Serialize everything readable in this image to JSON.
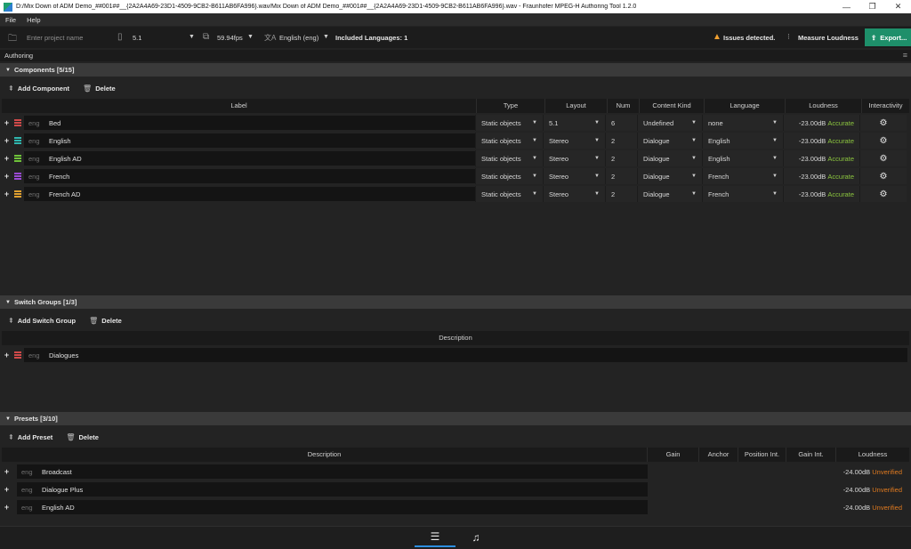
{
  "window": {
    "title": "D:/Mix Down of ADM Demo_##001##__{2A2A4A69-23D1-4509-9CB2-B611AB6FA996}.wav/Mix Down of ADM Demo_##001##__{2A2A4A69-23D1-4509-9CB2-B611AB6FA996}.wav - Fraunhofer MPEG-H Authoring Tool 1.2.0",
    "minimize": "—",
    "restore": "❐",
    "close": "✕"
  },
  "menu": {
    "file": "File",
    "help": "Help"
  },
  "toolbar": {
    "project_placeholder": "Enter project name",
    "layout": "5.1",
    "framerate": "59.94fps",
    "language": "English (eng)",
    "included_languages": "Included Languages: 1",
    "issues": "Issues detected.",
    "measure_loudness": "Measure Loudness",
    "export": "Export..."
  },
  "authoring_tab": "Authoring",
  "components": {
    "header": "Components [5/15]",
    "add": "Add Component",
    "delete": "Delete",
    "columns": [
      "Label",
      "Type",
      "Layout",
      "Num",
      "Content Kind",
      "Language",
      "Loudness",
      "Interactivity"
    ],
    "rows": [
      {
        "lang": "eng",
        "label": "Bed",
        "type": "Static objects",
        "layout": "5.1",
        "num": "6",
        "kind": "Undefined",
        "language": "none",
        "loudness": "-23.00dB",
        "status": "Accurate",
        "color": "#d14a4a"
      },
      {
        "lang": "eng",
        "label": "English",
        "type": "Static objects",
        "layout": "Stereo",
        "num": "2",
        "kind": "Dialogue",
        "language": "English",
        "loudness": "-23.00dB",
        "status": "Accurate",
        "color": "#2fb8b0"
      },
      {
        "lang": "eng",
        "label": "English AD",
        "type": "Static objects",
        "layout": "Stereo",
        "num": "2",
        "kind": "Dialogue",
        "language": "English",
        "loudness": "-23.00dB",
        "status": "Accurate",
        "color": "#6fc33a"
      },
      {
        "lang": "eng",
        "label": "French",
        "type": "Static objects",
        "layout": "Stereo",
        "num": "2",
        "kind": "Dialogue",
        "language": "French",
        "loudness": "-23.00dB",
        "status": "Accurate",
        "color": "#9a4ad4"
      },
      {
        "lang": "eng",
        "label": "French AD",
        "type": "Static objects",
        "layout": "Stereo",
        "num": "2",
        "kind": "Dialogue",
        "language": "French",
        "loudness": "-23.00dB",
        "status": "Accurate",
        "color": "#e0a030"
      }
    ]
  },
  "switch_groups": {
    "header": "Switch Groups [1/3]",
    "add": "Add Switch Group",
    "delete": "Delete",
    "columns": [
      "Description"
    ],
    "rows": [
      {
        "lang": "eng",
        "label": "Dialogues",
        "color": "#d14a4a"
      }
    ]
  },
  "presets": {
    "header": "Presets [3/10]",
    "add": "Add Preset",
    "delete": "Delete",
    "columns": [
      "Description",
      "Gain",
      "Anchor",
      "Position Int.",
      "Gain Int.",
      "Loudness"
    ],
    "rows": [
      {
        "lang": "eng",
        "label": "Broadcast",
        "loudness": "-24.00dB",
        "status": "Unverified"
      },
      {
        "lang": "eng",
        "label": "Dialogue Plus",
        "loudness": "-24.00dB",
        "status": "Unverified"
      },
      {
        "lang": "eng",
        "label": "English AD",
        "loudness": "-24.00dB",
        "status": "Unverified"
      }
    ]
  },
  "bottom_tabs": {
    "mixer_icon": "sliders-icon",
    "playlist_icon": "playlist-icon"
  }
}
